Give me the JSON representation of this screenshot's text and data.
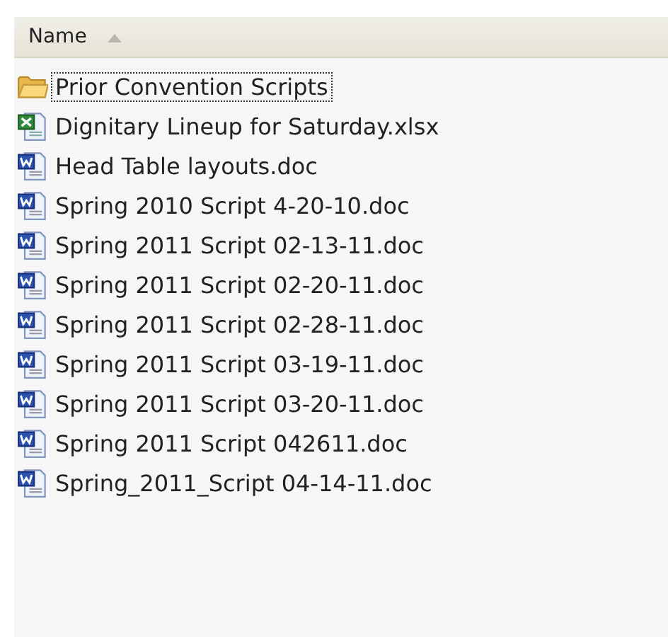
{
  "header": {
    "column": "Name",
    "sort_ascending": true
  },
  "files": [
    {
      "name": "Prior Convention Scripts",
      "kind": "folder",
      "focused": true
    },
    {
      "name": "Dignitary Lineup for Saturday.xlsx",
      "kind": "excel",
      "focused": false
    },
    {
      "name": "Head Table layouts.doc",
      "kind": "word",
      "focused": false
    },
    {
      "name": "Spring 2010 Script 4-20-10.doc",
      "kind": "word",
      "focused": false
    },
    {
      "name": "Spring 2011 Script 02-13-11.doc",
      "kind": "word",
      "focused": false
    },
    {
      "name": "Spring 2011 Script 02-20-11.doc",
      "kind": "word",
      "focused": false
    },
    {
      "name": "Spring 2011 Script 02-28-11.doc",
      "kind": "word",
      "focused": false
    },
    {
      "name": "Spring 2011 Script 03-19-11.doc",
      "kind": "word",
      "focused": false
    },
    {
      "name": "Spring 2011 Script 03-20-11.doc",
      "kind": "word",
      "focused": false
    },
    {
      "name": "Spring 2011 Script 042611.doc",
      "kind": "word",
      "focused": false
    },
    {
      "name": "Spring_2011_Script 04-14-11.doc",
      "kind": "word",
      "focused": false
    }
  ]
}
